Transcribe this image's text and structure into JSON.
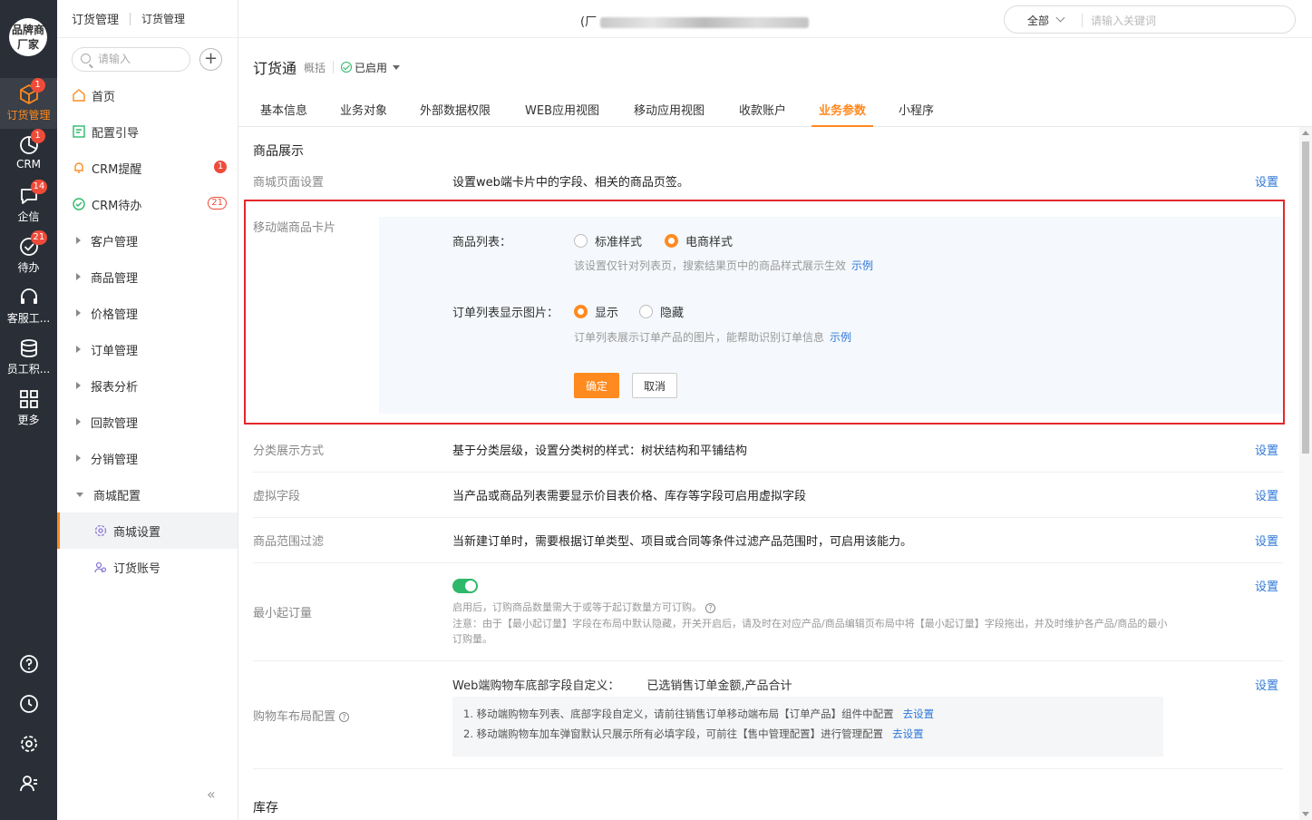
{
  "rail": {
    "logo": "品牌商厂家",
    "items": [
      {
        "label": "订货管理",
        "badge": "1",
        "icon": "box-icon"
      },
      {
        "label": "CRM",
        "badge": "1",
        "icon": "pie-icon"
      },
      {
        "label": "企信",
        "badge": "14",
        "icon": "chat-icon"
      },
      {
        "label": "待办",
        "badge": "21",
        "icon": "check-icon"
      },
      {
        "label": "客服工...",
        "badge": "",
        "icon": "headset-icon"
      },
      {
        "label": "员工积...",
        "badge": "",
        "icon": "coins-icon"
      },
      {
        "label": "更多",
        "badge": "",
        "icon": "grid-icon"
      }
    ]
  },
  "nav": {
    "title": "订货管理",
    "subtitle": "订货管理",
    "search_placeholder": "请输入",
    "items": [
      {
        "label": "首页",
        "icon": "home-icon"
      },
      {
        "label": "配置引导",
        "icon": "guide-icon"
      },
      {
        "label": "CRM提醒",
        "icon": "bell-icon",
        "badge": "1"
      },
      {
        "label": "CRM待办",
        "icon": "todo-icon",
        "badge": "21"
      },
      {
        "label": "客户管理"
      },
      {
        "label": "商品管理"
      },
      {
        "label": "价格管理"
      },
      {
        "label": "订单管理"
      },
      {
        "label": "报表分析"
      },
      {
        "label": "回款管理"
      },
      {
        "label": "分销管理"
      },
      {
        "label": "商城配置"
      }
    ],
    "sub_items": [
      {
        "label": "商城设置",
        "icon": "gear-icon"
      },
      {
        "label": "订货账号",
        "icon": "users-icon"
      }
    ]
  },
  "header": {
    "tenant_prefix": "(厂",
    "search_scope": "全部",
    "search_placeholder": "请输入关键词"
  },
  "app": {
    "title": "订货通",
    "overview": "概括",
    "status": "已启用"
  },
  "tabs": [
    "基本信息",
    "业务对象",
    "外部数据权限",
    "WEB应用视图",
    "移动应用视图",
    "收款账户",
    "业务参数",
    "小程序"
  ],
  "active_tab": "业务参数",
  "content": {
    "section1": "商品展示",
    "mall_page_label": "商城页面设置",
    "mall_page_desc": "设置web端卡片中的字段、相关的商品页签。",
    "set_link": "设置",
    "mobile_card_label": "移动端商品卡片",
    "product_list_label": "商品列表：",
    "opt_standard": "标准样式",
    "opt_ecom": "电商样式",
    "product_list_hint": "该设置仅针对列表页，搜索结果页中的商品样式展示生效",
    "example": "示例",
    "order_img_label": "订单列表显示图片：",
    "opt_show": "显示",
    "opt_hide": "隐藏",
    "order_img_hint": "订单列表展示订单产品的图片，能帮助识别订单信息",
    "btn_ok": "确定",
    "btn_cancel": "取消",
    "category_label": "分类展示方式",
    "category_desc": "基于分类层级，设置分类树的样式：树状结构和平铺结构",
    "virtual_label": "虚拟字段",
    "virtual_desc": "当产品或商品列表需要显示价目表价格、库存等字段可启用虚拟字段",
    "range_label": "商品范围过滤",
    "range_desc": "当新建订单时，需要根据订单类型、项目或合同等条件过滤产品范围时，可启用该能力。",
    "min_order_label": "最小起订量",
    "min_order_hint": "启用后，订购商品数量需大于或等于起订数量方可订购。",
    "min_order_note": "注意：由于【最小起订量】字段在布局中默认隐藏，开关开启后，请及时在对应产品/商品编辑页布局中将【最小起订量】字段拖出，并及时维护各产品/商品的最小订购量。",
    "cart_label": "购物车布局配置",
    "cart_summary_label": "Web端购物车底部字段自定义：",
    "cart_summary_value": "已选销售订单金额,产品合计",
    "cart_note1": "1. 移动端购物车列表、底部字段自定义，请前往销售订单移动端布局【订单产品】组件中配置",
    "cart_note2": "2. 移动端购物车加车弹窗默认只展示所有必填字段，可前往【售中管理配置】进行管理配置",
    "go_set": "去设置",
    "section2": "库存"
  },
  "colors": {
    "accent": "#ff8a1f",
    "link": "#2f78d8",
    "highlight_border": "#e3282d",
    "success": "#2eb86a"
  }
}
